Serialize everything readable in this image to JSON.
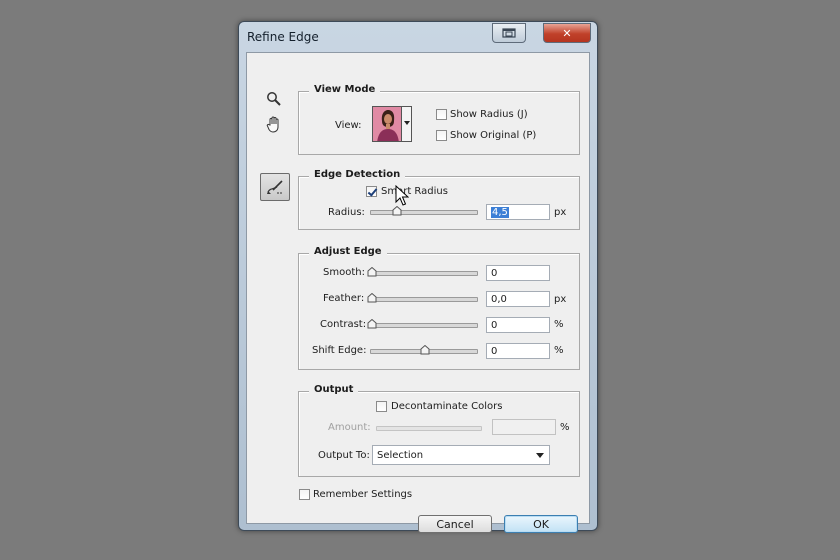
{
  "window": {
    "title": "Refine Edge"
  },
  "view_mode": {
    "legend": "View Mode",
    "view_label": "View:",
    "show_radius_label": "Show Radius (J)",
    "show_radius_checked": false,
    "show_original_label": "Show Original (P)",
    "show_original_checked": false
  },
  "edge_detection": {
    "legend": "Edge Detection",
    "smart_radius_label": "Smart Radius",
    "smart_radius_checked": true,
    "radius_label": "Radius:",
    "radius_value": "4,5",
    "radius_unit": "px"
  },
  "adjust_edge": {
    "legend": "Adjust Edge",
    "rows": [
      {
        "label": "Smooth:",
        "value": "0",
        "unit": ""
      },
      {
        "label": "Feather:",
        "value": "0,0",
        "unit": "px"
      },
      {
        "label": "Contrast:",
        "value": "0",
        "unit": "%"
      },
      {
        "label": "Shift Edge:",
        "value": "0",
        "unit": "%"
      }
    ]
  },
  "output": {
    "legend": "Output",
    "decontaminate_label": "Decontaminate Colors",
    "decontaminate_checked": false,
    "amount_label": "Amount:",
    "amount_value": "",
    "amount_unit": "%",
    "output_to_label": "Output To:",
    "output_to_value": "Selection"
  },
  "remember_settings_label": "Remember Settings",
  "remember_settings_checked": false,
  "buttons": {
    "cancel": "Cancel",
    "ok": "OK"
  },
  "tools": [
    "zoom-icon",
    "hand-icon",
    "refine-radius-brush-icon"
  ],
  "colors": {
    "desktop": "#7b7b7b",
    "dialog_bg": "#efefef",
    "selection_highlight": "#3c7fd6",
    "close_button": "#c0412a"
  }
}
